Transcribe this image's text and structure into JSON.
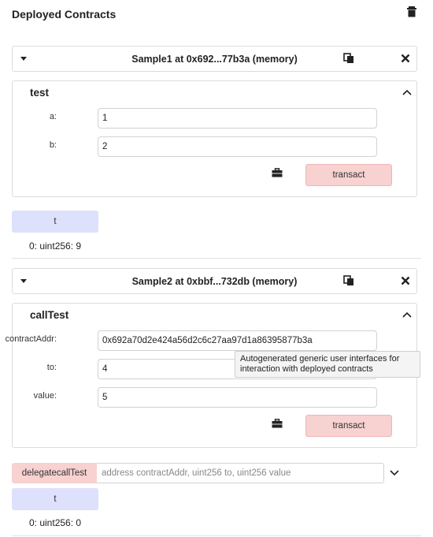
{
  "panel": {
    "title": "Deployed Contracts",
    "delete_icon": "trash-icon"
  },
  "contracts": [
    {
      "title": "Sample1 at 0x692...77b3a (memory)",
      "function": {
        "name": "test",
        "params": [
          {
            "label": "a:",
            "value": "1"
          },
          {
            "label": "b:",
            "value": "2"
          }
        ],
        "transact_label": "transact"
      },
      "getter": {
        "label": "t",
        "output": "0: uint256: 9"
      }
    },
    {
      "title": "Sample2 at 0xbbf...732db (memory)",
      "function": {
        "name": "callTest",
        "params": [
          {
            "label": "contractAddr:",
            "value": "0x692a70d2e424a56d2c6c27aa97d1a86395877b3a"
          },
          {
            "label": "to:",
            "value": "4"
          },
          {
            "label": "value:",
            "value": "5"
          }
        ],
        "transact_label": "transact"
      },
      "delegate": {
        "label": "delegatecallTest",
        "placeholder": "address contractAddr, uint256 to, uint256 value"
      },
      "getter": {
        "label": "t",
        "output": "0: uint256: 0"
      }
    }
  ],
  "tooltip": {
    "text": "Autogenerated generic user interfaces for interaction with deployed contracts"
  }
}
